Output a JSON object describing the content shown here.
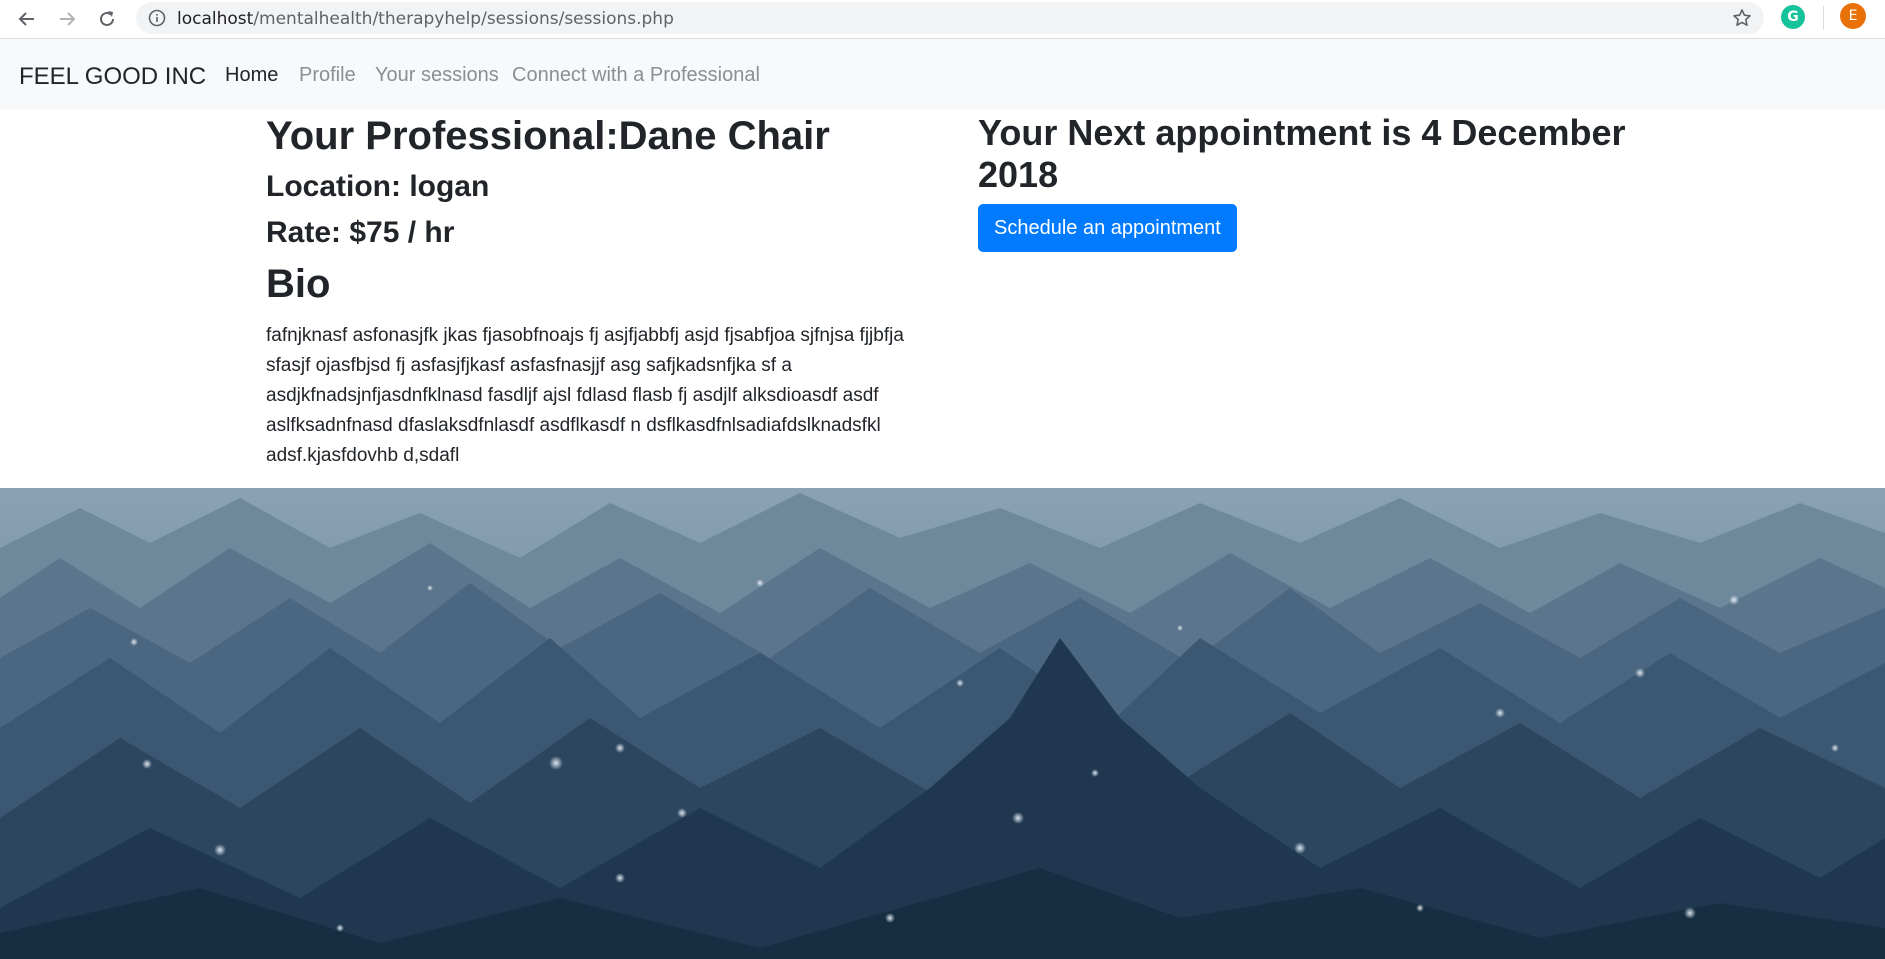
{
  "browser": {
    "url_host": "localhost",
    "url_path": "/mentalhealth/therapyhelp/sessions/sessions.php",
    "extension_letter": "G",
    "profile_letter": "E"
  },
  "navbar": {
    "brand": "FEEL GOOD INC",
    "links": [
      {
        "label": "Home",
        "active": true
      },
      {
        "label": "Profile",
        "active": false
      },
      {
        "label": "Your sessions",
        "active": false
      },
      {
        "label": "Connect with a Professional",
        "active": false
      }
    ]
  },
  "professional": {
    "title": "Your Professional:Dane Chair",
    "location": "Location: logan",
    "rate": "Rate: $75 / hr",
    "bio_heading": "Bio",
    "bio_text": "fafnjknasf asfonasjfk jkas fjasobfnoajs fj asjfjabbfj asjd fjsabfjoa sjfnjsa fjjbfja sfasjf ojasfbjsd fj asfasjfjkasf asfasfnasjjf asg safjkadsnfjka sf a asdjkfnadsjnfjasdnfklnasd fasdljf ajsl fdlasd flasb fj asdjlf alksdioasdf asdf aslfksadnfnasd dfaslaksdfnlasdf asdflkasdf n dsflkasdfnlsadiafdslknadsfkl adsf.kjasfdovhb d,sdafl"
  },
  "appointment": {
    "heading": "Your Next appointment is 4 December 2018",
    "button_label": "Schedule an appointment"
  },
  "colors": {
    "primary": "#007bff",
    "navbar_bg": "#f8f9fa",
    "scene_dark": "#1b3147",
    "scene_light": "#7e97aa"
  }
}
